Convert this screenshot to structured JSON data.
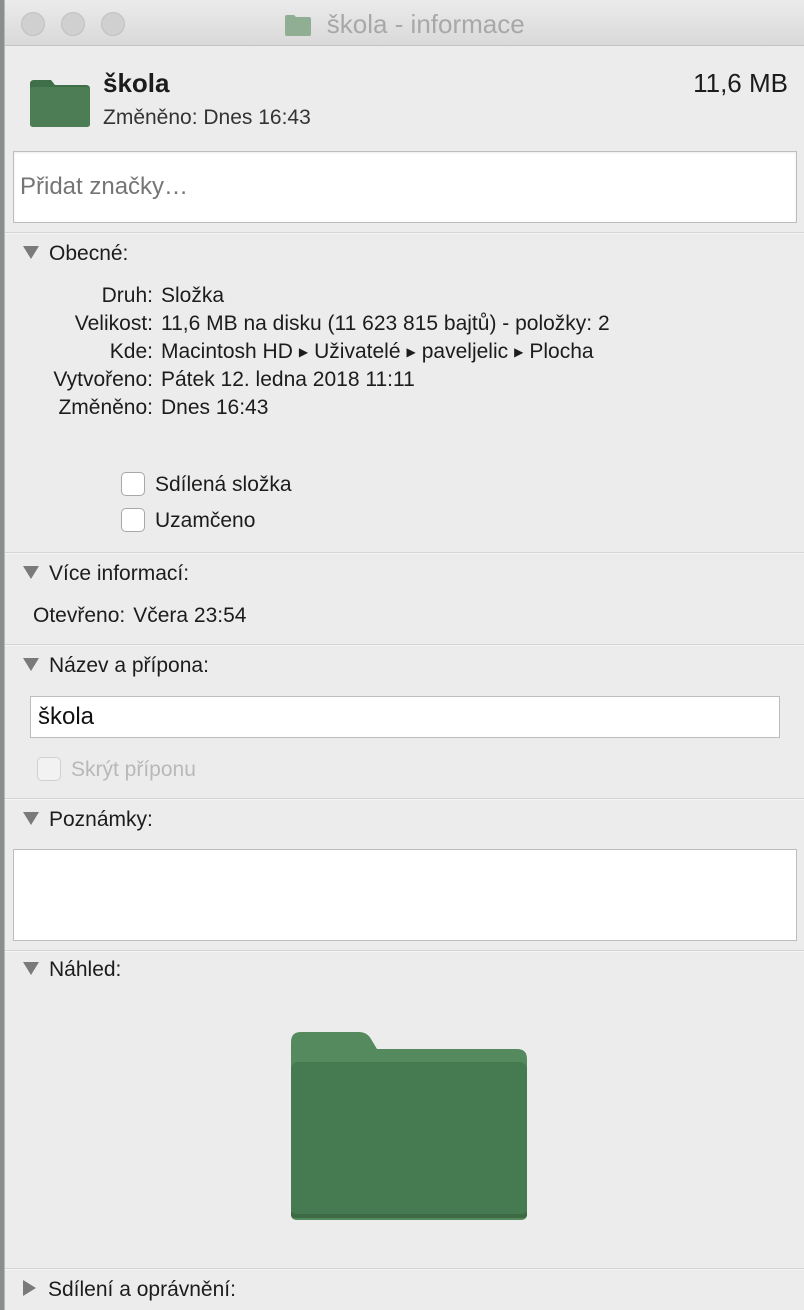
{
  "window": {
    "title": "škola - informace"
  },
  "header": {
    "name": "škola",
    "size": "11,6 MB",
    "modified": "Změněno: Dnes 16:43"
  },
  "tags": {
    "placeholder": "Přidat značky…"
  },
  "general": {
    "title": "Obecné:",
    "rows": [
      {
        "key": "Druh:",
        "value": "Složka"
      },
      {
        "key": "Velikost:",
        "value": "11,6 MB na disku (11 623 815 bajtů) - položky: 2"
      },
      {
        "key": "Kde:",
        "path": [
          "Macintosh HD",
          "Uživatelé",
          "paveljelic",
          "Plocha"
        ]
      },
      {
        "key": "Vytvořeno:",
        "value": "Pátek 12. ledna 2018 11:11"
      },
      {
        "key": "Změněno:",
        "value": "Dnes 16:43"
      }
    ],
    "shared_folder": "Sdílená složka",
    "locked": "Uzamčeno"
  },
  "more_info": {
    "title": "Více informací:",
    "opened_key": "Otevřeno:",
    "opened_value": "Včera 23:54"
  },
  "name_ext": {
    "title": "Název a přípona:",
    "value": "škola",
    "hide_ext": "Skrýt příponu"
  },
  "notes": {
    "title": "Poznámky:"
  },
  "preview": {
    "title": "Náhled:"
  },
  "sharing": {
    "title": "Sdílení a oprávnění:"
  },
  "colors": {
    "folder": "#4c7d54",
    "folder_tab": "#568b5e"
  }
}
